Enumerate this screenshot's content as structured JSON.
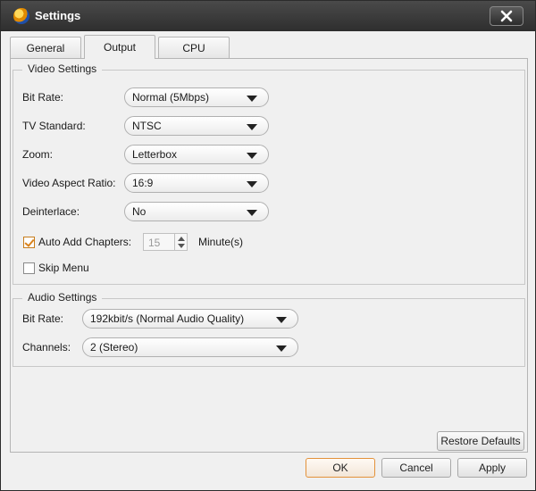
{
  "window": {
    "title": "Settings"
  },
  "tabs": [
    {
      "label": "General",
      "active": false
    },
    {
      "label": "Output",
      "active": true
    },
    {
      "label": "CPU",
      "active": false
    }
  ],
  "video_settings": {
    "legend": "Video Settings",
    "bit_rate": {
      "label": "Bit Rate:",
      "value": "Normal (5Mbps)"
    },
    "tv_standard": {
      "label": "TV Standard:",
      "value": "NTSC"
    },
    "zoom": {
      "label": "Zoom:",
      "value": "Letterbox"
    },
    "aspect_ratio": {
      "label": "Video Aspect Ratio:",
      "value": "16:9"
    },
    "deinterlace": {
      "label": "Deinterlace:",
      "value": "No"
    },
    "auto_add_chapters": {
      "label": "Auto Add Chapters:",
      "checked": true,
      "value": "15",
      "unit": "Minute(s)"
    },
    "skip_menu": {
      "label": "Skip Menu",
      "checked": false
    }
  },
  "audio_settings": {
    "legend": "Audio Settings",
    "bit_rate": {
      "label": "Bit Rate:",
      "value": "192kbit/s (Normal Audio Quality)"
    },
    "channels": {
      "label": "Channels:",
      "value": "2 (Stereo)"
    }
  },
  "buttons": {
    "restore_defaults": "Restore Defaults",
    "ok": "OK",
    "cancel": "Cancel",
    "apply": "Apply"
  },
  "colors": {
    "titlebar": "#3a3a3a",
    "accent": "#e3923b",
    "background": "#f0f0f0"
  }
}
